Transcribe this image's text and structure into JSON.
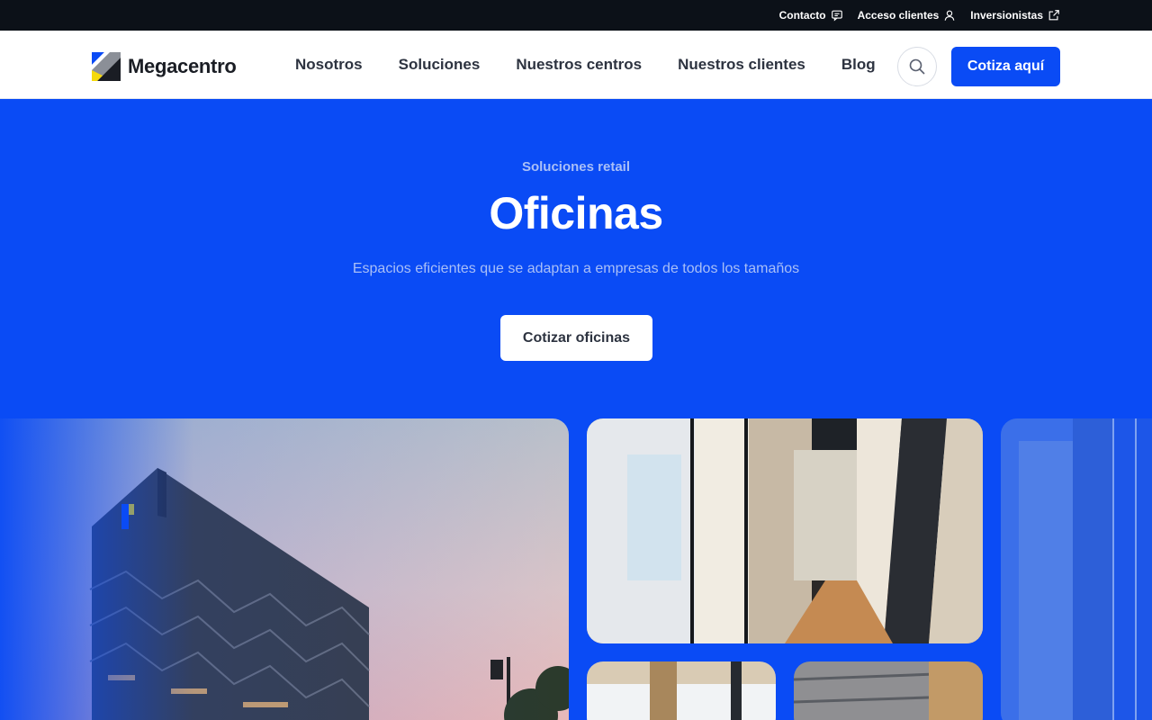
{
  "topbar": {
    "contact_label": "Contacto",
    "client_access_label": "Acceso clientes",
    "investors_label": "Inversionistas"
  },
  "nav": {
    "logo_text": "Megacentro",
    "items": [
      {
        "label": "Nosotros"
      },
      {
        "label": "Soluciones"
      },
      {
        "label": "Nuestros centros"
      },
      {
        "label": "Nuestros clientes"
      },
      {
        "label": "Blog"
      }
    ],
    "cta_label": "Cotiza aquí"
  },
  "hero": {
    "eyebrow": "Soluciones retail",
    "title": "Oficinas",
    "subtitle": "Espacios eficientes que se adaptan a empresas de todos los tamaños",
    "button_label": "Cotizar oficinas"
  },
  "colors": {
    "brand_blue": "#0a4bf5",
    "topbar_bg": "#0c1118",
    "nav_text": "#2d3340",
    "muted_text": "#a9bff7"
  },
  "icons": {
    "contact": "chat-icon",
    "client_access": "user-icon",
    "investors": "external-link-icon",
    "search": "search-icon"
  }
}
